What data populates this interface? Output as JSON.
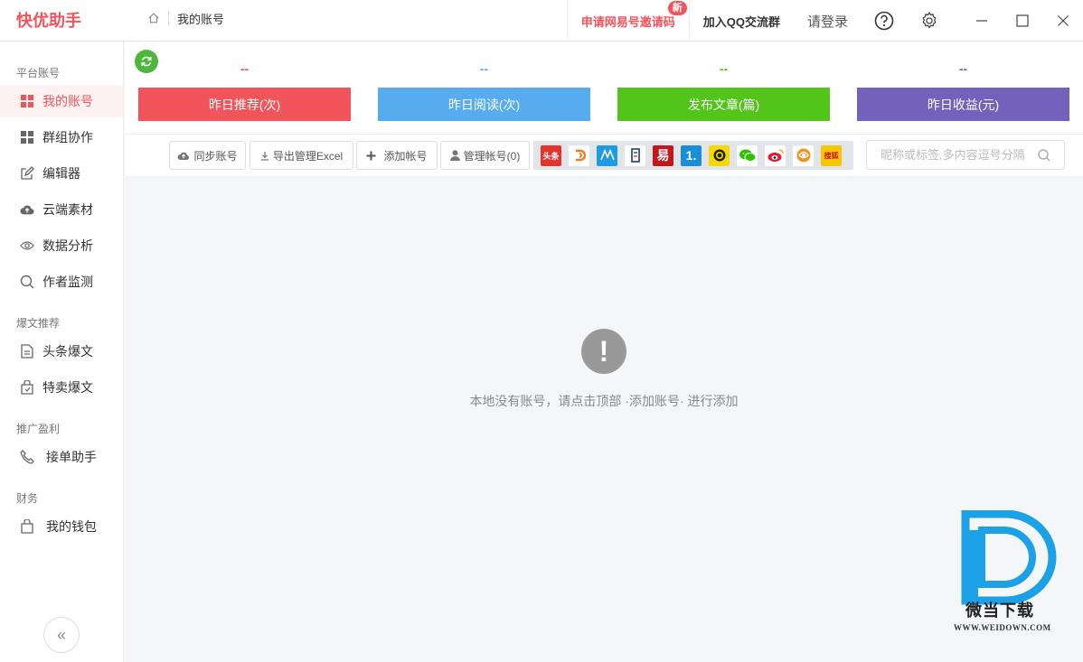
{
  "app": {
    "title": "快优助手"
  },
  "breadcrumb": {
    "current": "我的账号"
  },
  "topbar": {
    "apply_label": "申请网易号邀请码",
    "new_badge": "新",
    "qq_label": "加入QQ交流群",
    "login_label": "请登录"
  },
  "sidebar": {
    "sections": [
      {
        "title": "平台账号"
      },
      {
        "title": "爆文推荐"
      },
      {
        "title": "推广盈利"
      },
      {
        "title": "财务"
      }
    ],
    "items": [
      {
        "label": "我的账号",
        "icon": "grid-icon",
        "active": true
      },
      {
        "label": "群组协作",
        "icon": "grid-icon"
      },
      {
        "label": "编辑器",
        "icon": "edit-icon"
      },
      {
        "label": "云端素材",
        "icon": "cloud-upload-icon"
      },
      {
        "label": "数据分析",
        "icon": "eye-icon"
      },
      {
        "label": "作者监测",
        "icon": "search-icon"
      },
      {
        "label": "头条爆文",
        "icon": "document-icon"
      },
      {
        "label": "特卖爆文",
        "icon": "shopping-bag-icon"
      },
      {
        "label": "接单助手",
        "icon": "phone-icon"
      },
      {
        "label": "我的钱包",
        "icon": "bag-icon"
      }
    ],
    "collapse_glyph": "«"
  },
  "stats": [
    {
      "value": "--",
      "label": "昨日推荐(次)",
      "color": "#f2545b"
    },
    {
      "value": "--",
      "label": "昨日阅读(次)",
      "color": "#56acef"
    },
    {
      "value": "--",
      "label": "发布文章(篇)",
      "color": "#52c41a"
    },
    {
      "value": "--",
      "label": "昨日收益(元)",
      "color": "#7262bc"
    }
  ],
  "toolbar": {
    "sync_label": "同步账号",
    "export_label": "导出管理Excel",
    "add_label": "添加帐号",
    "manage_label": "管理帐号(0)",
    "search_placeholder": "昵称或标签,多内容逗号分隔"
  },
  "platforms": [
    {
      "name": "toutiao-icon",
      "text": "头条",
      "color": "#e5322d"
    },
    {
      "name": "dayu-icon",
      "text": "",
      "color": "#ffffff"
    },
    {
      "name": "baijia-icon",
      "text": "",
      "color": "#1c9ce3"
    },
    {
      "name": "qiehao-icon",
      "text": "",
      "color": "#ffffff"
    },
    {
      "name": "wangyi-icon",
      "text": "易",
      "color": "#c4161c"
    },
    {
      "name": "yidian-icon",
      "text": "1.",
      "color": "#1a8fd8"
    },
    {
      "name": "souhu-icon",
      "text": "",
      "color": "#f6d900"
    },
    {
      "name": "wechat-icon",
      "text": "",
      "color": "#2dc100"
    },
    {
      "name": "weibo-icon",
      "text": "",
      "color": "#ffffff"
    },
    {
      "name": "fenghuang-icon",
      "text": "",
      "color": "#ffffff"
    },
    {
      "name": "sougou-icon",
      "text": "搜狐",
      "color": "#f6c600"
    }
  ],
  "empty_state": {
    "message": "本地没有账号，请点击顶部 ·添加账号· 进行添加"
  },
  "watermark": {
    "title": "微当下载",
    "url": "WWW.WEIDOWN.COM"
  }
}
